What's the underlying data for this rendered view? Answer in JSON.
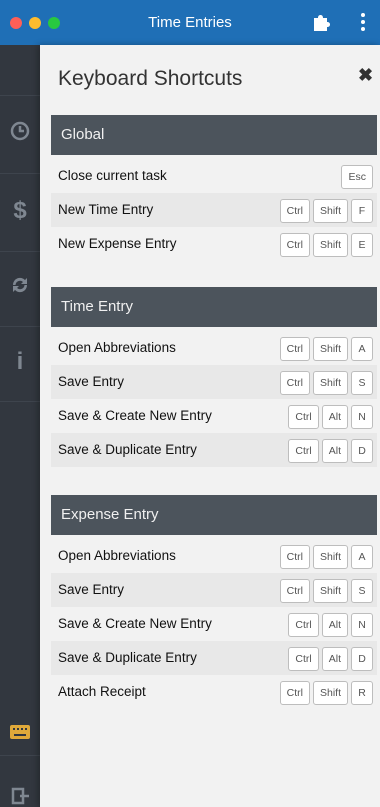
{
  "app": {
    "title": "Time Entries"
  },
  "panel": {
    "title": "Keyboard Shortcuts",
    "close": "✖"
  },
  "sections": [
    {
      "title": "Global",
      "rows": [
        {
          "label": "Close current task",
          "keys": [
            "Esc"
          ]
        },
        {
          "label": "New Time Entry",
          "keys": [
            "Ctrl",
            "Shift",
            "F"
          ]
        },
        {
          "label": "New Expense Entry",
          "keys": [
            "Ctrl",
            "Shift",
            "E"
          ]
        }
      ]
    },
    {
      "title": "Time Entry",
      "rows": [
        {
          "label": "Open Abbreviations",
          "keys": [
            "Ctrl",
            "Shift",
            "A"
          ]
        },
        {
          "label": "Save Entry",
          "keys": [
            "Ctrl",
            "Shift",
            "S"
          ]
        },
        {
          "label": "Save & Create New Entry",
          "keys": [
            "Ctrl",
            "Alt",
            "N"
          ]
        },
        {
          "label": "Save & Duplicate Entry",
          "keys": [
            "Ctrl",
            "Alt",
            "D"
          ]
        }
      ]
    },
    {
      "title": "Expense Entry",
      "rows": [
        {
          "label": "Open Abbreviations",
          "keys": [
            "Ctrl",
            "Shift",
            "A"
          ]
        },
        {
          "label": "Save Entry",
          "keys": [
            "Ctrl",
            "Shift",
            "S"
          ]
        },
        {
          "label": "Save & Create New Entry",
          "keys": [
            "Ctrl",
            "Alt",
            "N"
          ]
        },
        {
          "label": "Save & Duplicate Entry",
          "keys": [
            "Ctrl",
            "Alt",
            "D"
          ]
        },
        {
          "label": "Attach Receipt",
          "keys": [
            "Ctrl",
            "Shift",
            "R"
          ]
        }
      ]
    }
  ],
  "sidebar": {
    "icons": [
      "clock-icon",
      "dollar-icon",
      "sync-icon",
      "info-icon",
      "keyboard-icon",
      "logout-icon"
    ]
  },
  "colors": {
    "titlebar": "#1f6fb6",
    "section_header": "#4c545c",
    "sidebar": "#32373f"
  }
}
